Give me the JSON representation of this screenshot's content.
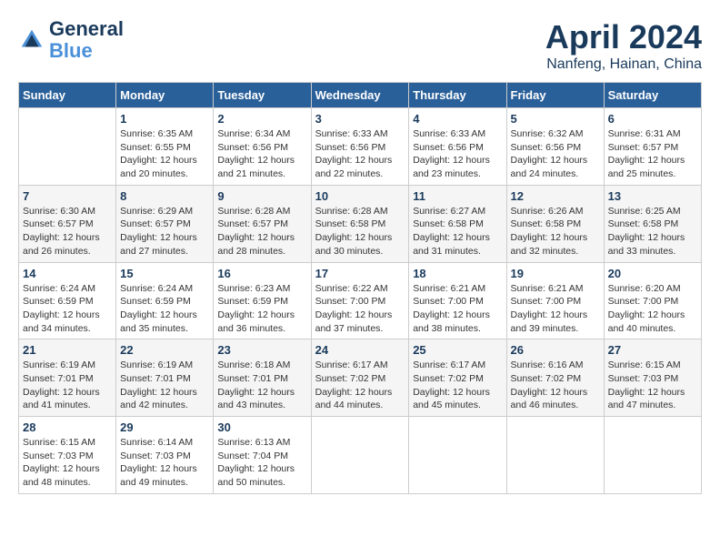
{
  "header": {
    "logo_line1": "General",
    "logo_line2": "Blue",
    "month_year": "April 2024",
    "location": "Nanfeng, Hainan, China"
  },
  "days_of_week": [
    "Sunday",
    "Monday",
    "Tuesday",
    "Wednesday",
    "Thursday",
    "Friday",
    "Saturday"
  ],
  "weeks": [
    [
      {
        "day": "",
        "info": ""
      },
      {
        "day": "1",
        "info": "Sunrise: 6:35 AM\nSunset: 6:55 PM\nDaylight: 12 hours\nand 20 minutes."
      },
      {
        "day": "2",
        "info": "Sunrise: 6:34 AM\nSunset: 6:56 PM\nDaylight: 12 hours\nand 21 minutes."
      },
      {
        "day": "3",
        "info": "Sunrise: 6:33 AM\nSunset: 6:56 PM\nDaylight: 12 hours\nand 22 minutes."
      },
      {
        "day": "4",
        "info": "Sunrise: 6:33 AM\nSunset: 6:56 PM\nDaylight: 12 hours\nand 23 minutes."
      },
      {
        "day": "5",
        "info": "Sunrise: 6:32 AM\nSunset: 6:56 PM\nDaylight: 12 hours\nand 24 minutes."
      },
      {
        "day": "6",
        "info": "Sunrise: 6:31 AM\nSunset: 6:57 PM\nDaylight: 12 hours\nand 25 minutes."
      }
    ],
    [
      {
        "day": "7",
        "info": "Sunrise: 6:30 AM\nSunset: 6:57 PM\nDaylight: 12 hours\nand 26 minutes."
      },
      {
        "day": "8",
        "info": "Sunrise: 6:29 AM\nSunset: 6:57 PM\nDaylight: 12 hours\nand 27 minutes."
      },
      {
        "day": "9",
        "info": "Sunrise: 6:28 AM\nSunset: 6:57 PM\nDaylight: 12 hours\nand 28 minutes."
      },
      {
        "day": "10",
        "info": "Sunrise: 6:28 AM\nSunset: 6:58 PM\nDaylight: 12 hours\nand 30 minutes."
      },
      {
        "day": "11",
        "info": "Sunrise: 6:27 AM\nSunset: 6:58 PM\nDaylight: 12 hours\nand 31 minutes."
      },
      {
        "day": "12",
        "info": "Sunrise: 6:26 AM\nSunset: 6:58 PM\nDaylight: 12 hours\nand 32 minutes."
      },
      {
        "day": "13",
        "info": "Sunrise: 6:25 AM\nSunset: 6:58 PM\nDaylight: 12 hours\nand 33 minutes."
      }
    ],
    [
      {
        "day": "14",
        "info": "Sunrise: 6:24 AM\nSunset: 6:59 PM\nDaylight: 12 hours\nand 34 minutes."
      },
      {
        "day": "15",
        "info": "Sunrise: 6:24 AM\nSunset: 6:59 PM\nDaylight: 12 hours\nand 35 minutes."
      },
      {
        "day": "16",
        "info": "Sunrise: 6:23 AM\nSunset: 6:59 PM\nDaylight: 12 hours\nand 36 minutes."
      },
      {
        "day": "17",
        "info": "Sunrise: 6:22 AM\nSunset: 7:00 PM\nDaylight: 12 hours\nand 37 minutes."
      },
      {
        "day": "18",
        "info": "Sunrise: 6:21 AM\nSunset: 7:00 PM\nDaylight: 12 hours\nand 38 minutes."
      },
      {
        "day": "19",
        "info": "Sunrise: 6:21 AM\nSunset: 7:00 PM\nDaylight: 12 hours\nand 39 minutes."
      },
      {
        "day": "20",
        "info": "Sunrise: 6:20 AM\nSunset: 7:00 PM\nDaylight: 12 hours\nand 40 minutes."
      }
    ],
    [
      {
        "day": "21",
        "info": "Sunrise: 6:19 AM\nSunset: 7:01 PM\nDaylight: 12 hours\nand 41 minutes."
      },
      {
        "day": "22",
        "info": "Sunrise: 6:19 AM\nSunset: 7:01 PM\nDaylight: 12 hours\nand 42 minutes."
      },
      {
        "day": "23",
        "info": "Sunrise: 6:18 AM\nSunset: 7:01 PM\nDaylight: 12 hours\nand 43 minutes."
      },
      {
        "day": "24",
        "info": "Sunrise: 6:17 AM\nSunset: 7:02 PM\nDaylight: 12 hours\nand 44 minutes."
      },
      {
        "day": "25",
        "info": "Sunrise: 6:17 AM\nSunset: 7:02 PM\nDaylight: 12 hours\nand 45 minutes."
      },
      {
        "day": "26",
        "info": "Sunrise: 6:16 AM\nSunset: 7:02 PM\nDaylight: 12 hours\nand 46 minutes."
      },
      {
        "day": "27",
        "info": "Sunrise: 6:15 AM\nSunset: 7:03 PM\nDaylight: 12 hours\nand 47 minutes."
      }
    ],
    [
      {
        "day": "28",
        "info": "Sunrise: 6:15 AM\nSunset: 7:03 PM\nDaylight: 12 hours\nand 48 minutes."
      },
      {
        "day": "29",
        "info": "Sunrise: 6:14 AM\nSunset: 7:03 PM\nDaylight: 12 hours\nand 49 minutes."
      },
      {
        "day": "30",
        "info": "Sunrise: 6:13 AM\nSunset: 7:04 PM\nDaylight: 12 hours\nand 50 minutes."
      },
      {
        "day": "",
        "info": ""
      },
      {
        "day": "",
        "info": ""
      },
      {
        "day": "",
        "info": ""
      },
      {
        "day": "",
        "info": ""
      }
    ]
  ]
}
